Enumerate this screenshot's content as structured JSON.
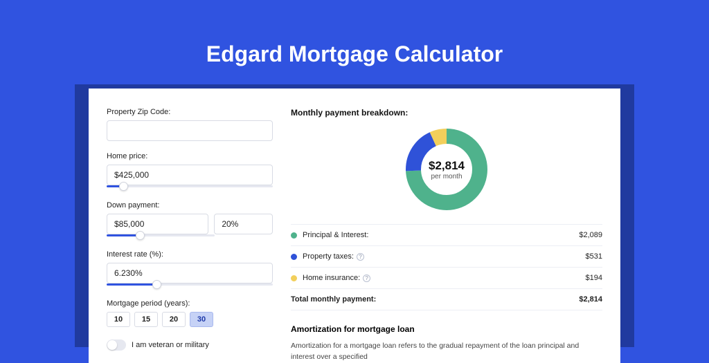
{
  "page": {
    "title": "Edgard Mortgage Calculator"
  },
  "form": {
    "zip": {
      "label": "Property Zip Code:",
      "value": ""
    },
    "homePrice": {
      "label": "Home price:",
      "value": "$425,000",
      "sliderPct": 10
    },
    "downPayment": {
      "label": "Down payment:",
      "value": "$85,000",
      "pct": "20%",
      "sliderPct": 20
    },
    "interest": {
      "label": "Interest rate (%):",
      "value": "6.230%",
      "sliderPct": 30
    },
    "period": {
      "label": "Mortgage period (years):",
      "options": [
        "10",
        "15",
        "20",
        "30"
      ],
      "selected": "30"
    },
    "veteran": {
      "label": "I am veteran or military",
      "checked": false
    }
  },
  "breakdown": {
    "title": "Monthly payment breakdown:",
    "centerValue": "$2,814",
    "centerSub": "per month",
    "items": [
      {
        "name": "Principal & Interest:",
        "value": "$2,089",
        "color": "#4fb28c",
        "pct": 74.2,
        "help": false
      },
      {
        "name": "Property taxes:",
        "value": "$531",
        "color": "#2f52d8",
        "pct": 18.9,
        "help": true
      },
      {
        "name": "Home insurance:",
        "value": "$194",
        "color": "#f2cf5b",
        "pct": 6.9,
        "help": true
      }
    ],
    "totalLabel": "Total monthly payment:",
    "totalValue": "$2,814"
  },
  "amort": {
    "title": "Amortization for mortgage loan",
    "text": "Amortization for a mortgage loan refers to the gradual repayment of the loan principal and interest over a specified"
  },
  "chart_data": {
    "type": "pie",
    "title": "Monthly payment breakdown",
    "categories": [
      "Principal & Interest",
      "Property taxes",
      "Home insurance"
    ],
    "values": [
      2089,
      531,
      194
    ],
    "colors": [
      "#4fb28c",
      "#2f52d8",
      "#f2cf5b"
    ],
    "center_label": "$2,814 per month",
    "total": 2814
  }
}
